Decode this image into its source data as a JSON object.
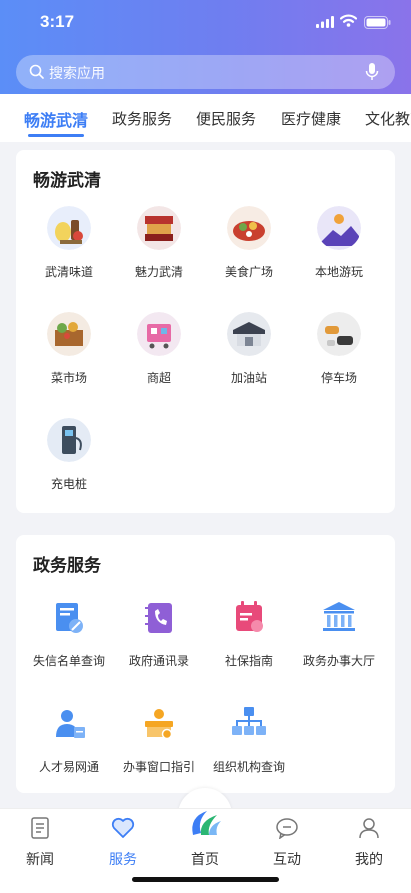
{
  "status_bar": {
    "time": "3:17"
  },
  "search": {
    "placeholder": "搜索应用"
  },
  "tabs": [
    {
      "label": "畅游武清"
    },
    {
      "label": "政务服务"
    },
    {
      "label": "便民服务"
    },
    {
      "label": "医疗健康"
    },
    {
      "label": "文化教育"
    }
  ],
  "tour_section": {
    "title": "畅游武清",
    "items": [
      {
        "label": "武清味道",
        "icon": "food-taste-icon"
      },
      {
        "label": "魅力武清",
        "icon": "theater-icon"
      },
      {
        "label": "美食广场",
        "icon": "food-court-icon"
      },
      {
        "label": "本地游玩",
        "icon": "local-travel-icon"
      },
      {
        "label": "菜市场",
        "icon": "vegetable-market-icon"
      },
      {
        "label": "商超",
        "icon": "supermarket-icon"
      },
      {
        "label": "加油站",
        "icon": "gas-station-icon"
      },
      {
        "label": "停车场",
        "icon": "parking-icon"
      },
      {
        "label": "充电桩",
        "icon": "charging-pile-icon"
      }
    ]
  },
  "gov_section": {
    "title": "政务服务",
    "items": [
      {
        "label": "失信名单查询",
        "icon": "blacklist-query-icon"
      },
      {
        "label": "政府通讯录",
        "icon": "phonebook-icon"
      },
      {
        "label": "社保指南",
        "icon": "social-security-icon"
      },
      {
        "label": "政务办事大厅",
        "icon": "government-hall-icon"
      },
      {
        "label": "人才易网通",
        "icon": "talent-icon"
      },
      {
        "label": "办事窗口指引",
        "icon": "service-window-icon"
      },
      {
        "label": "组织机构查询",
        "icon": "org-chart-icon"
      }
    ]
  },
  "tabbar": [
    {
      "label": "新闻",
      "icon": "news-icon"
    },
    {
      "label": "服务",
      "icon": "heart-icon"
    },
    {
      "label": "首页",
      "icon": "home-logo-icon"
    },
    {
      "label": "互动",
      "icon": "chat-bubble-icon"
    },
    {
      "label": "我的",
      "icon": "user-icon"
    }
  ],
  "colors": {
    "accent": "#3d7ef5",
    "gov_icon_blue": "#4a8ff0",
    "gov_icon_orange": "#f5a623",
    "gov_icon_pink": "#e84a7a"
  }
}
